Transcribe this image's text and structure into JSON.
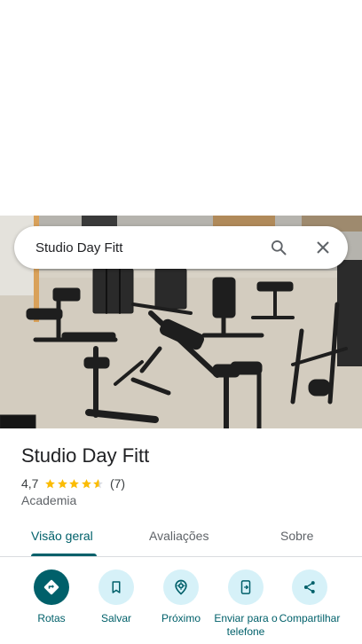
{
  "search": {
    "query": "Studio Day Fitt"
  },
  "place": {
    "title": "Studio Day Fitt",
    "rating": "4,7",
    "stars": 4.7,
    "review_count": "(7)",
    "category": "Academia"
  },
  "tabs": [
    {
      "label": "Visão geral"
    },
    {
      "label": "Avaliações"
    },
    {
      "label": "Sobre"
    }
  ],
  "actions": [
    {
      "label": "Rotas",
      "icon": "directions-icon"
    },
    {
      "label": "Salvar",
      "icon": "bookmark-icon"
    },
    {
      "label": "Próximo",
      "icon": "nearby-icon"
    },
    {
      "label": "Enviar para o telefone",
      "icon": "send-to-phone-icon"
    },
    {
      "label": "Compartilhar",
      "icon": "share-icon"
    }
  ],
  "colors": {
    "accent": "#00606a",
    "action_bg": "#d6f1f8",
    "star": "#fbbc04"
  }
}
